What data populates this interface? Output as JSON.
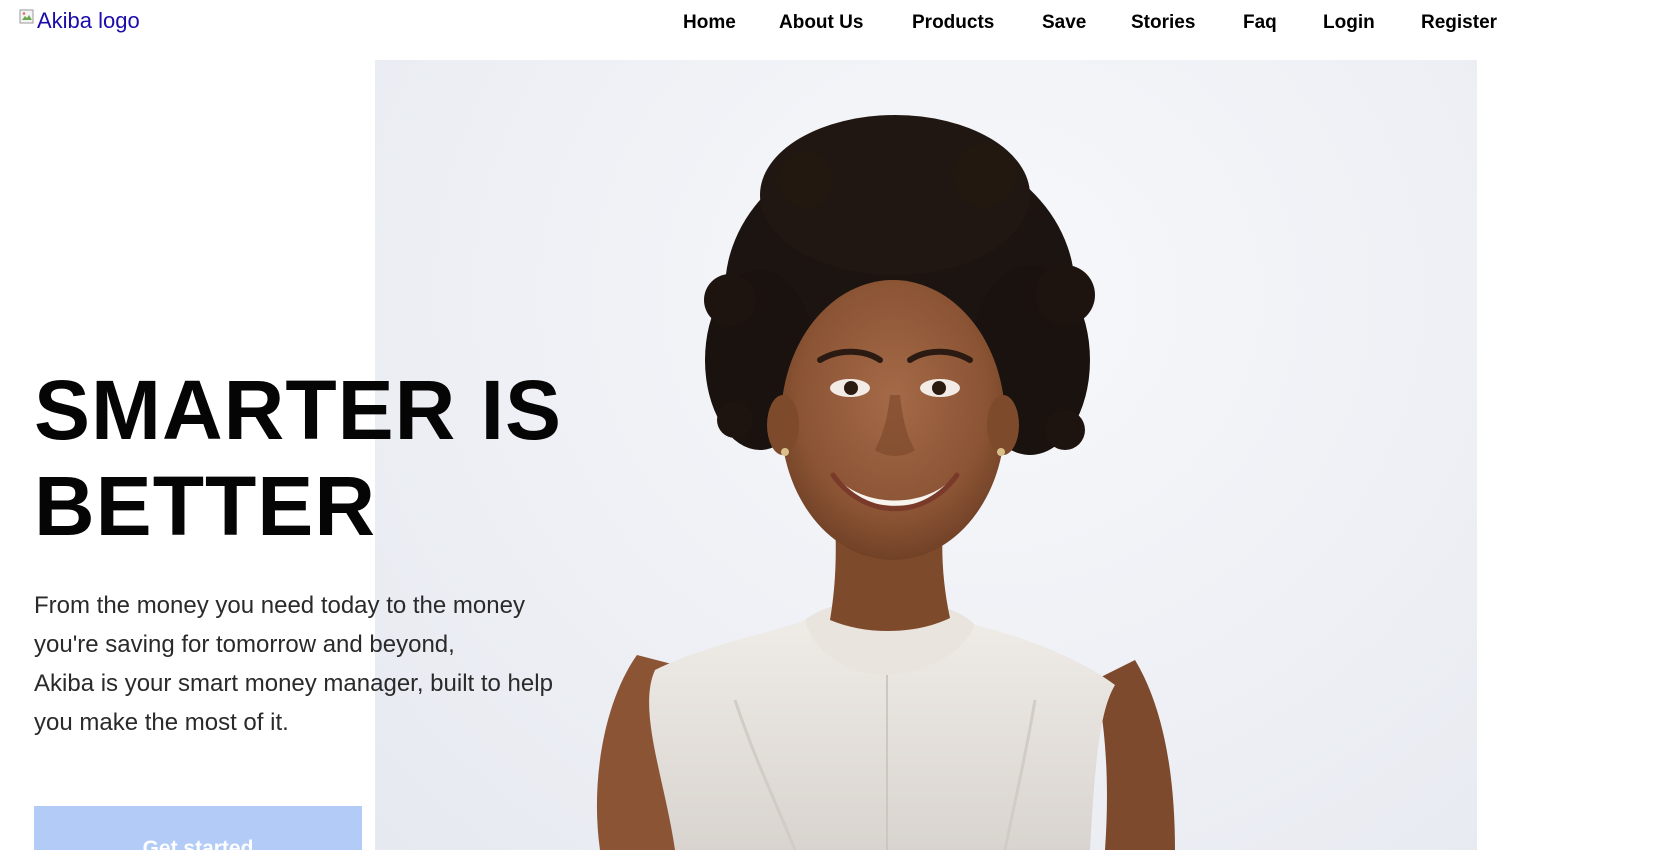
{
  "header": {
    "logo_alt": "Akiba logo",
    "nav": [
      {
        "label": "Home"
      },
      {
        "label": "About Us"
      },
      {
        "label": "Products"
      },
      {
        "label": "Save"
      },
      {
        "label": "Stories"
      },
      {
        "label": "Faq"
      },
      {
        "label": "Login"
      },
      {
        "label": "Register"
      }
    ]
  },
  "hero": {
    "headline_line1": "SMARTER IS",
    "headline_line2": "BETTER",
    "description_lines": [
      "From the money you need today to the money",
      "you're saving for tomorrow and beyond,",
      "Akiba is your smart money manager, built to help",
      "you make the most of it."
    ],
    "cta_label": "Get started",
    "cta_color": "#b3cbf7",
    "photo_background": "#eef0f5"
  }
}
